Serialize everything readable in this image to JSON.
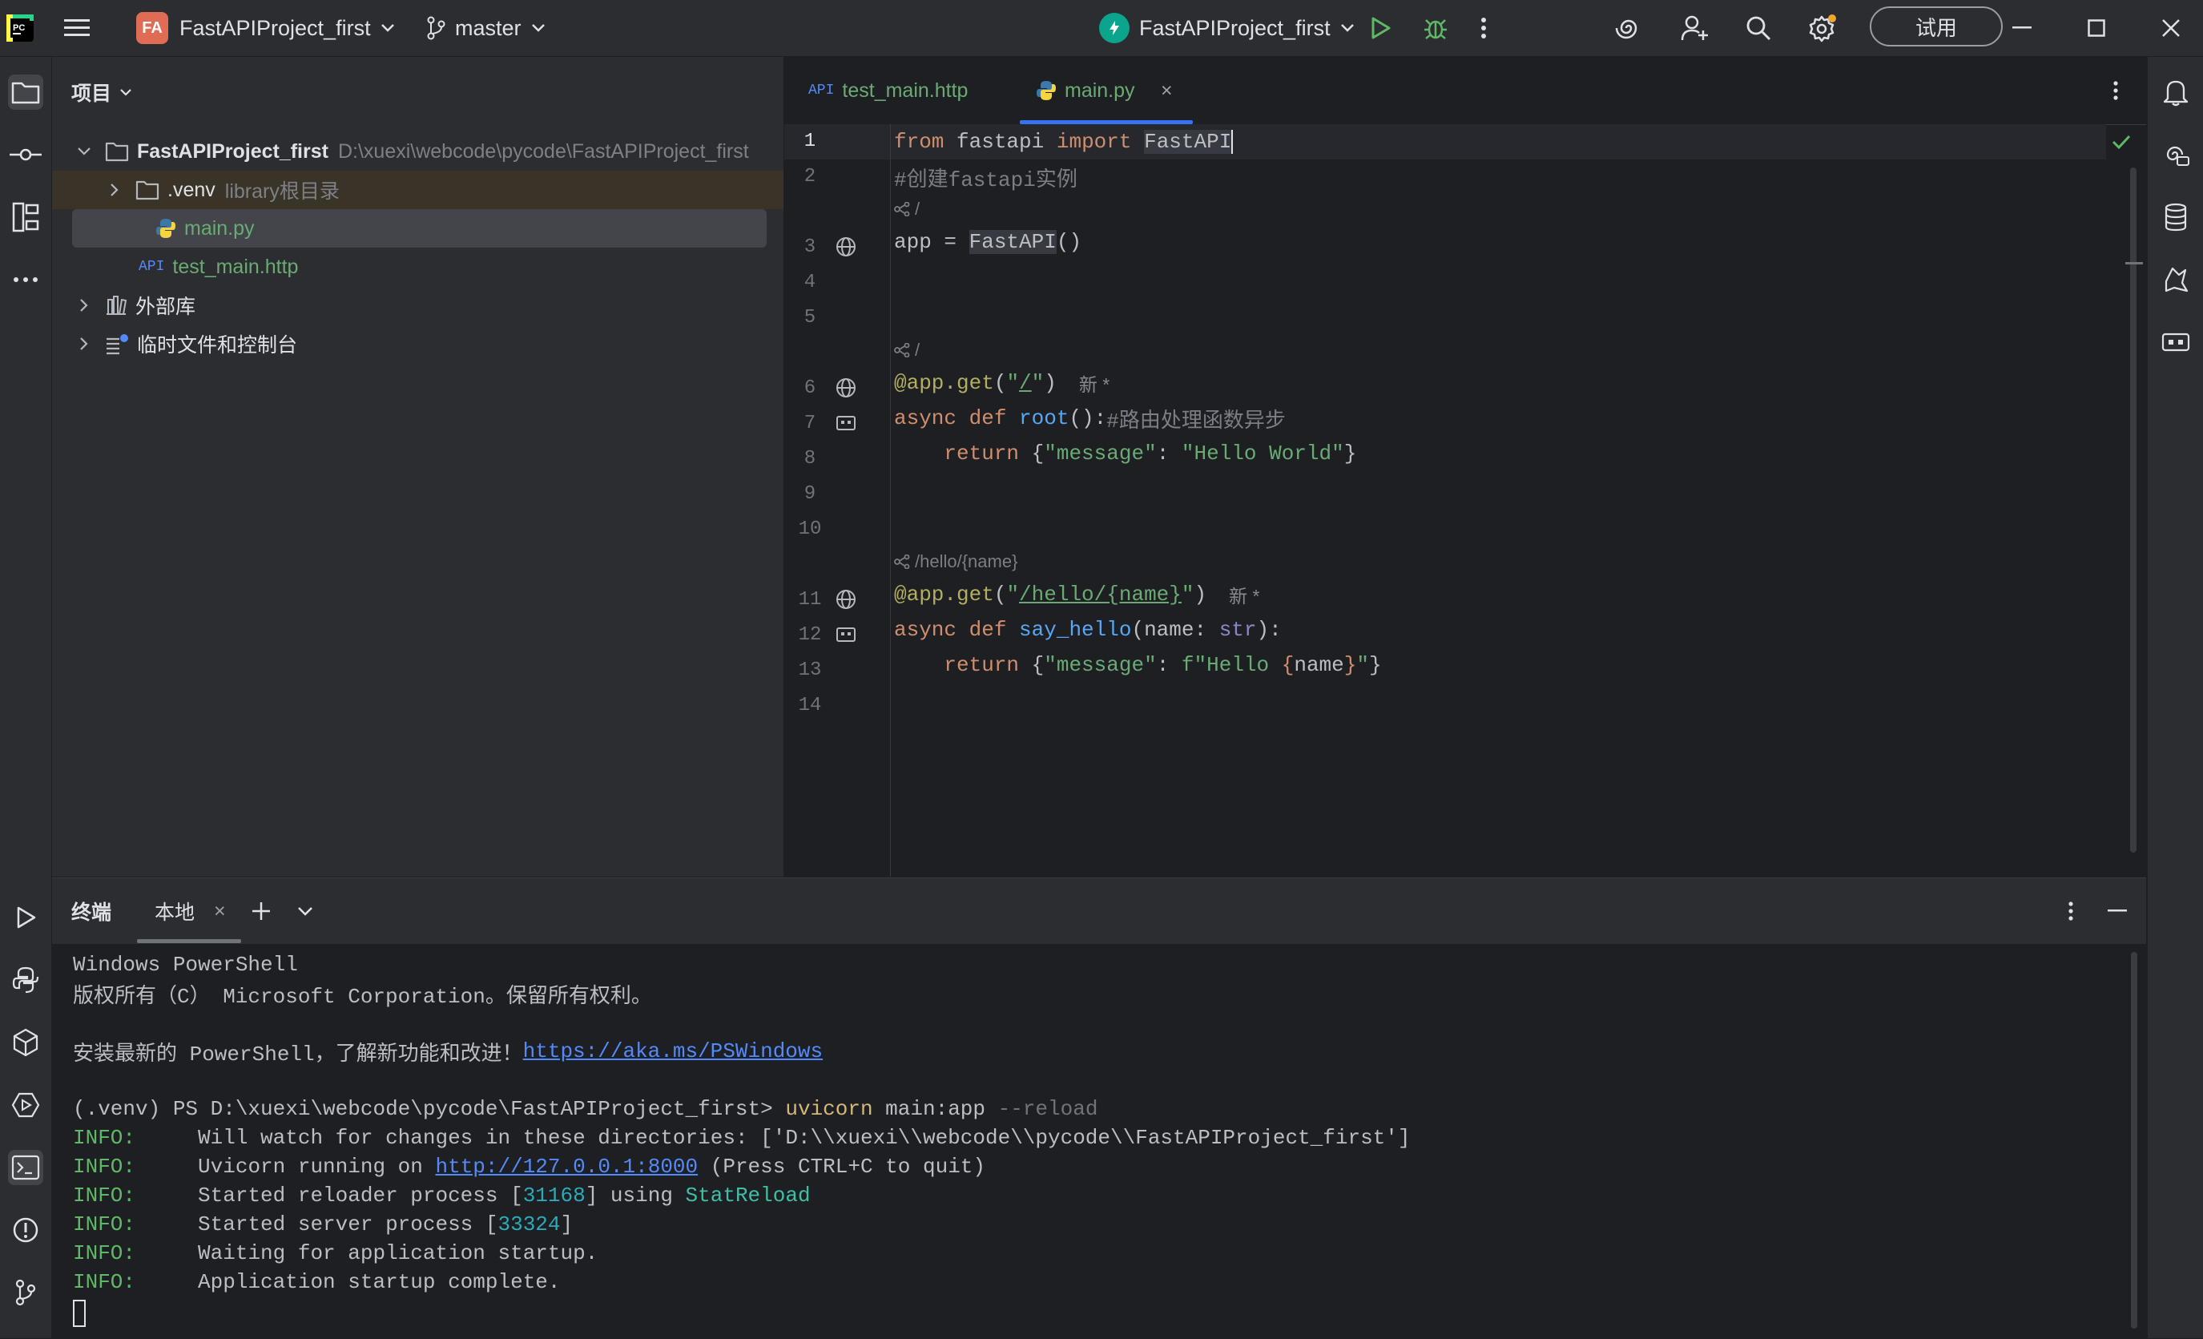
{
  "titlebar": {
    "project_badge": "FA",
    "project_name": "FastAPIProject_first",
    "branch": "master",
    "run_config": "FastAPIProject_first",
    "trial_button": "试用"
  },
  "project_panel": {
    "title": "项目",
    "tree": [
      {
        "name": "FastAPIProject_first",
        "hint": "D:\\xuexi\\webcode\\pycode\\FastAPIProject_first"
      },
      {
        "name": ".venv",
        "hint": "library根目录"
      },
      {
        "name": "main.py"
      },
      {
        "name": "test_main.http",
        "tag": "API"
      },
      {
        "name": "外部库"
      },
      {
        "name": "临时文件和控制台"
      }
    ]
  },
  "editor": {
    "tabs": [
      {
        "tag": "API",
        "label": "test_main.http"
      },
      {
        "label": "main.py",
        "close": "×"
      }
    ],
    "line_numbers": [
      "1",
      "2",
      "3",
      "4",
      "5",
      "6",
      "7",
      "8",
      "9",
      "10",
      "11",
      "12",
      "13",
      "14"
    ],
    "route_hints": [
      "/",
      "/",
      "/hello/{name}"
    ],
    "inlay_new": "新 *",
    "code": {
      "l1": {
        "a": "from",
        "b": " fastapi ",
        "c": "import",
        "d": "FastAPI"
      },
      "l2": "#创建fastapi实例",
      "l3": {
        "a": "app = ",
        "b": "FastAPI",
        "c": "()"
      },
      "l6": {
        "a": "@app.get",
        "b": "(",
        "c": "\"",
        "d": "/",
        "e": "\"",
        "f": ")"
      },
      "l7": {
        "a": "async def ",
        "b": "root",
        "c": "():",
        "d": "#路由处理函数异步"
      },
      "l8": {
        "a": "    return ",
        "b": "{",
        "c": "\"message\"",
        "d": ": ",
        "e": "\"Hello World\"",
        "f": "}"
      },
      "l11": {
        "a": "@app.get",
        "b": "(",
        "c": "\"",
        "d": "/hello/{name}",
        "e": "\"",
        "f": ")"
      },
      "l12": {
        "a": "async def ",
        "b": "say_hello",
        "c": "(name: ",
        "d": "str",
        "e": "):"
      },
      "l13": {
        "a": "    return ",
        "b": "{",
        "c": "\"message\"",
        "d": ": ",
        "e": "f\"Hello ",
        "f": "{",
        "g": "name",
        "h": "}",
        "i": "\"",
        "j": "}"
      }
    }
  },
  "terminal": {
    "title": "终端",
    "tab_local": "本地",
    "close": "×",
    "lines": {
      "t1": "Windows PowerShell",
      "t2": "版权所有（C） Microsoft Corporation。保留所有权利。",
      "t3a": "安装最新的 PowerShell，了解新功能和改进！",
      "t3b": "https://aka.ms/PSWindows",
      "t4a": "(.venv) PS D:\\xuexi\\webcode\\pycode\\FastAPIProject_first> ",
      "t4b": "uvicorn",
      "t4c": " main:app ",
      "t4d": "--reload",
      "info": "INFO:",
      "t5": "     Will watch for changes in these directories: ['D:\\\\xuexi\\\\webcode\\\\pycode\\\\FastAPIProject_first']",
      "t6a": "     Uvicorn running on ",
      "t6b": "http://127.0.0.1:8000",
      "t6c": " (Press CTRL+C to quit)",
      "t7a": "     Started reloader process [",
      "t7b": "31168",
      "t7c": "] using ",
      "t7d": "StatReload",
      "t8a": "     Started server process [",
      "t8b": "33324",
      "t8c": "]",
      "t9": "     Waiting for application startup.",
      "t10": "     Application startup complete."
    }
  }
}
